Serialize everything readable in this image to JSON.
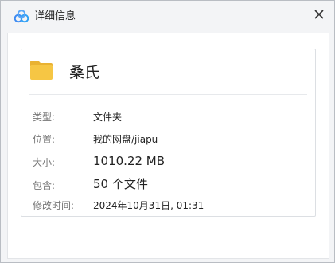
{
  "window": {
    "title": "详细信息"
  },
  "folder": {
    "name": "桑氏"
  },
  "details": {
    "type_label": "类型:",
    "type_value": "文件夹",
    "location_label": "位置:",
    "location_value": "我的网盘/jiapu",
    "size_label": "大小:",
    "size_value": "1010.22 MB",
    "contains_label": "包含:",
    "contains_value": "50 个文件",
    "modified_label": "修改时间:",
    "modified_value": "2024年10月31日, 01:31"
  },
  "colors": {
    "folder_yellow": "#f6c644",
    "folder_tab": "#e9b232",
    "logo_blue": "#3d8bf2"
  }
}
